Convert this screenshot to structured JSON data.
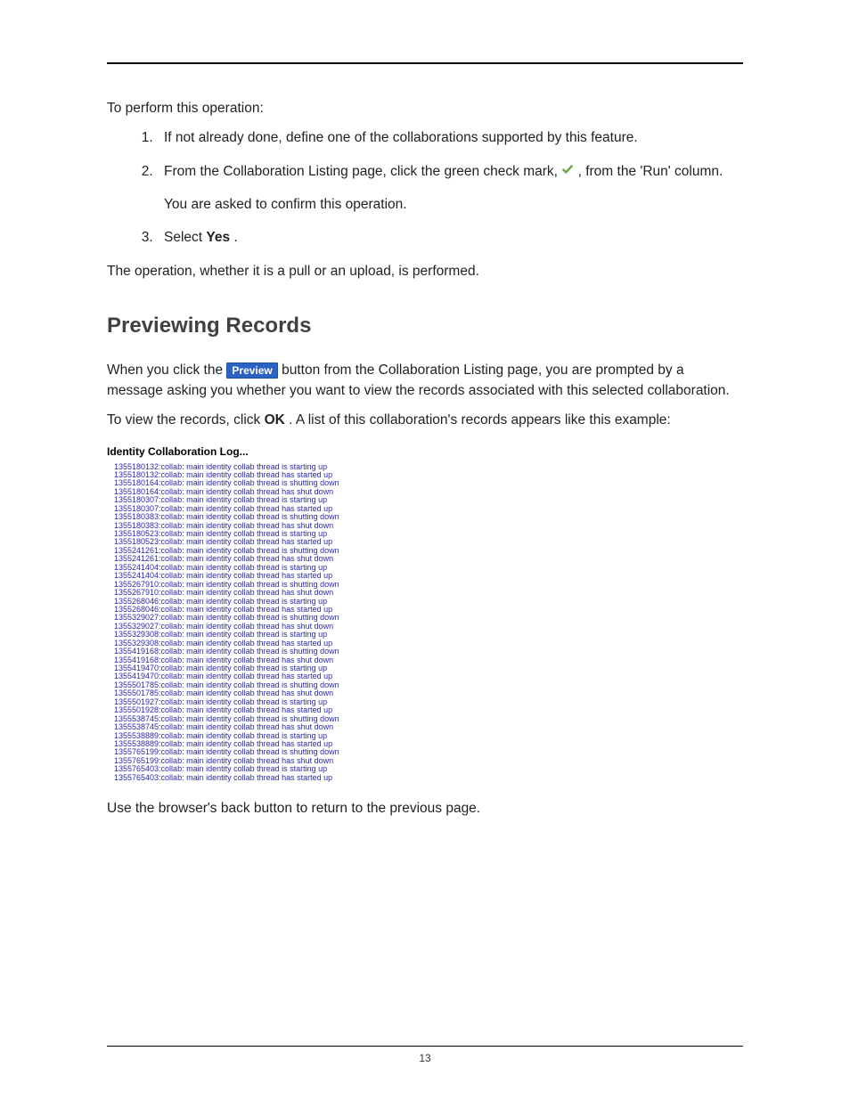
{
  "intro": "To perform this operation:",
  "steps": {
    "s1": "If not already done, define one of the collaborations supported by this feature.",
    "s2a": "From the Collaboration Listing page, click the green check mark, ",
    "s2b": ", from the 'Run' column.",
    "s2_sub": "You are asked to confirm this operation.",
    "s3a": "Select ",
    "s3b": "Yes",
    "s3c": "."
  },
  "after_steps": "The operation, whether it is a pull or an upload, is performed.",
  "heading": "Previewing Records",
  "p1a": "When you click the ",
  "preview_label": "Preview",
  "p1b": " button from the Collaboration Listing page, you are prompted by a message asking you whether you want to view the records associated with this selected collaboration.",
  "p2a": "To view the records, click ",
  "p2b": "OK",
  "p2c": ". A list of this collaboration's records appears like this example:",
  "log_title": "Identity Collaboration Log...",
  "log_lines": "1355180132:collab: main identity collab thread is starting up\n1355180132:collab: main identity collab thread has started up\n1355180164:collab: main identity collab thread is shutting down\n1355180164:collab: main identity collab thread has shut down\n1355180307:collab: main identity collab thread is starting up\n1355180307:collab: main identity collab thread has started up\n1355180383:collab: main identity collab thread is shutting down\n1355180383:collab: main identity collab thread has shut down\n1355180523:collab: main identity collab thread is starting up\n1355180523:collab: main identity collab thread has started up\n1355241261:collab: main identity collab thread is shutting down\n1355241261:collab: main identity collab thread has shut down\n1355241404:collab: main identity collab thread is starting up\n1355241404:collab: main identity collab thread has started up\n1355267910:collab: main identity collab thread is shutting down\n1355267910:collab: main identity collab thread has shut down\n1355268046:collab: main identity collab thread is starting up\n1355268046:collab: main identity collab thread has started up\n1355329027:collab: main identity collab thread is shutting down\n1355329027:collab: main identity collab thread has shut down\n1355329308:collab: main identity collab thread is starting up\n1355329308:collab: main identity collab thread has started up\n1355419168:collab: main identity collab thread is shutting down\n1355419168:collab: main identity collab thread has shut down\n1355419470:collab: main identity collab thread is starting up\n1355419470:collab: main identity collab thread has started up\n1355501785:collab: main identity collab thread is shutting down\n1355501785:collab: main identity collab thread has shut down\n1355501927:collab: main identity collab thread is starting up\n1355501928:collab: main identity collab thread has started up\n1355538745:collab: main identity collab thread is shutting down\n1355538745:collab: main identity collab thread has shut down\n1355538889:collab: main identity collab thread is starting up\n1355538889:collab: main identity collab thread has started up\n1355765199:collab: main identity collab thread is shutting down\n1355765199:collab: main identity collab thread has shut down\n1355765403:collab: main identity collab thread is starting up\n1355765403:collab: main identity collab thread has started up",
  "after_log": "Use the browser's back button to return to the previous page.",
  "page_number": "13"
}
